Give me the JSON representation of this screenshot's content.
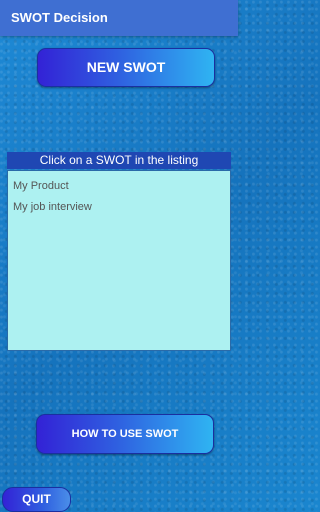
{
  "app_bar": {
    "title": "SWOT Decision"
  },
  "buttons": {
    "new_swot": "NEW SWOT",
    "how_to_use": "HOW TO USE SWOT",
    "quit": "QUIT"
  },
  "listing": {
    "header": "Click on a SWOT in the listing",
    "items": [
      {
        "label": "My Product"
      },
      {
        "label": "My job interview"
      }
    ]
  },
  "colors": {
    "app_bar": "#3f6fd2",
    "listing_background": "#adf1f1",
    "listing_header": "#1f47b3"
  }
}
